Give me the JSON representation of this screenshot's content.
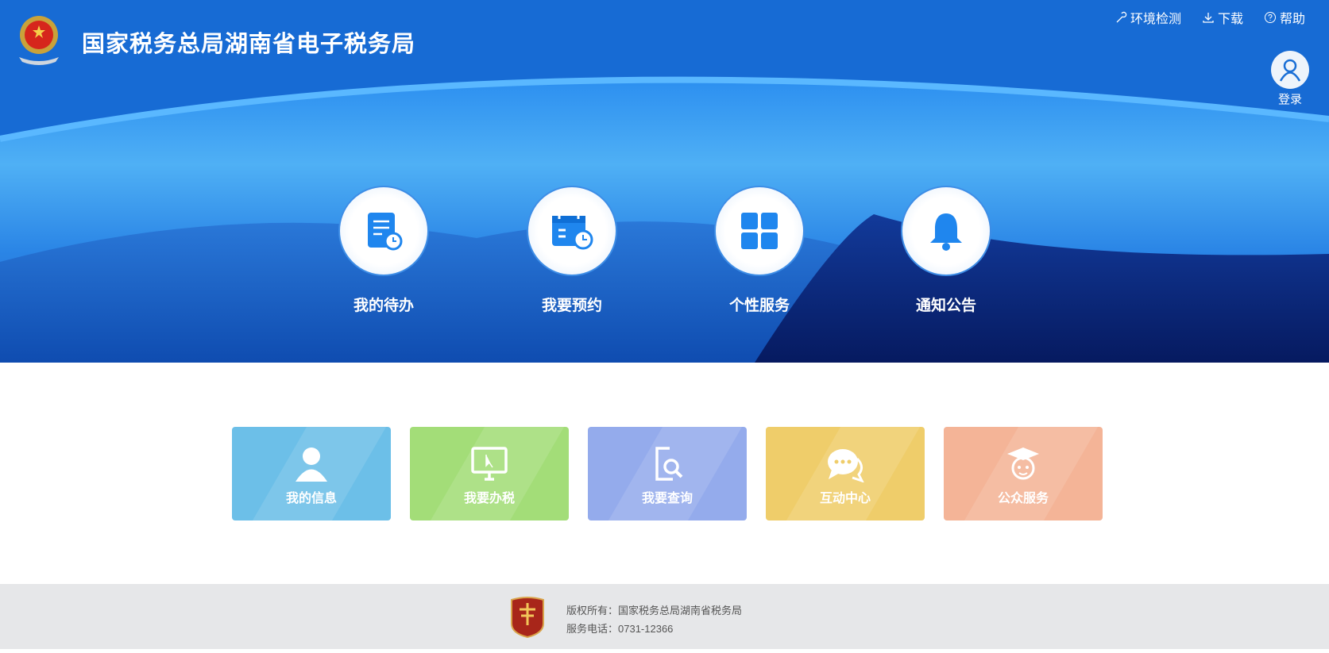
{
  "header": {
    "title": "国家税务总局湖南省电子税务局",
    "links": [
      {
        "label": "环境检测",
        "icon": "wrench-icon"
      },
      {
        "label": "下载",
        "icon": "download-icon"
      },
      {
        "label": "帮助",
        "icon": "help-icon"
      }
    ],
    "login": "登录"
  },
  "quick": [
    {
      "label": "我的待办",
      "icon": "todo-icon"
    },
    {
      "label": "我要预约",
      "icon": "calendar-icon"
    },
    {
      "label": "个性服务",
      "icon": "grid-icon"
    },
    {
      "label": "通知公告",
      "icon": "bell-icon"
    }
  ],
  "cards": [
    {
      "label": "我的信息",
      "color": "#6cbfe8"
    },
    {
      "label": "我要办税",
      "color": "#a3dd78"
    },
    {
      "label": "我要查询",
      "color": "#94abec"
    },
    {
      "label": "互动中心",
      "color": "#efcd6a"
    },
    {
      "label": "公众服务",
      "color": "#f4b497"
    }
  ],
  "footer": {
    "copyright": "版权所有：国家税务总局湖南省税务局",
    "phone": "服务电话：0731-12366"
  }
}
